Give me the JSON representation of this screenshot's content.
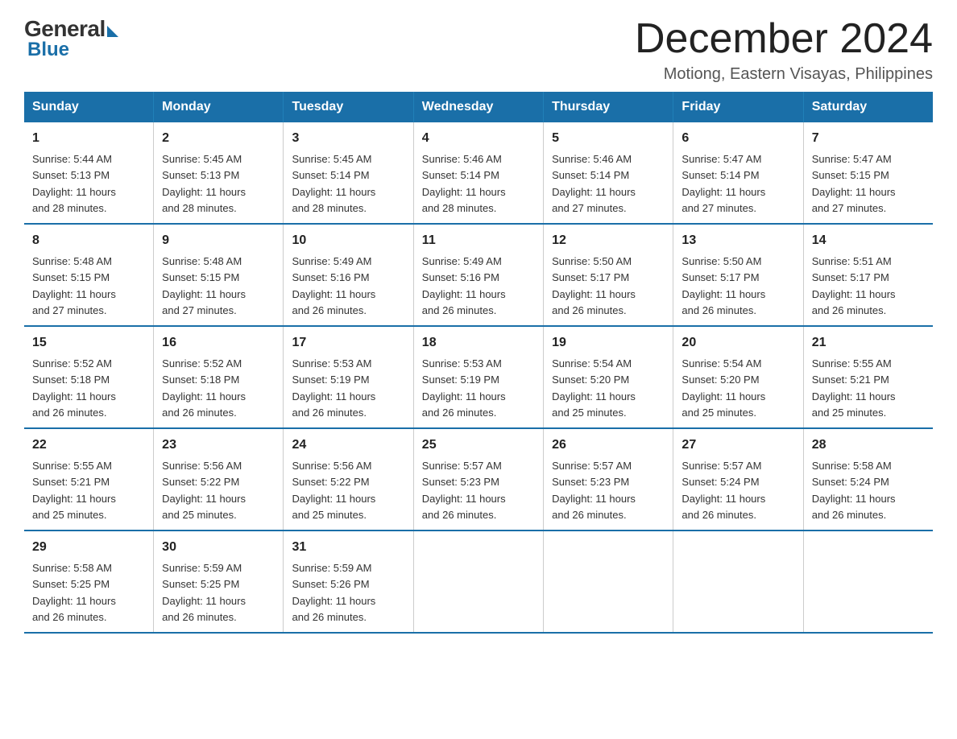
{
  "logo": {
    "general": "General",
    "blue": "Blue"
  },
  "title": "December 2024",
  "subtitle": "Motiong, Eastern Visayas, Philippines",
  "days_header": [
    "Sunday",
    "Monday",
    "Tuesday",
    "Wednesday",
    "Thursday",
    "Friday",
    "Saturday"
  ],
  "weeks": [
    [
      {
        "day": "1",
        "sunrise": "5:44 AM",
        "sunset": "5:13 PM",
        "daylight": "11 hours and 28 minutes."
      },
      {
        "day": "2",
        "sunrise": "5:45 AM",
        "sunset": "5:13 PM",
        "daylight": "11 hours and 28 minutes."
      },
      {
        "day": "3",
        "sunrise": "5:45 AM",
        "sunset": "5:14 PM",
        "daylight": "11 hours and 28 minutes."
      },
      {
        "day": "4",
        "sunrise": "5:46 AM",
        "sunset": "5:14 PM",
        "daylight": "11 hours and 28 minutes."
      },
      {
        "day": "5",
        "sunrise": "5:46 AM",
        "sunset": "5:14 PM",
        "daylight": "11 hours and 27 minutes."
      },
      {
        "day": "6",
        "sunrise": "5:47 AM",
        "sunset": "5:14 PM",
        "daylight": "11 hours and 27 minutes."
      },
      {
        "day": "7",
        "sunrise": "5:47 AM",
        "sunset": "5:15 PM",
        "daylight": "11 hours and 27 minutes."
      }
    ],
    [
      {
        "day": "8",
        "sunrise": "5:48 AM",
        "sunset": "5:15 PM",
        "daylight": "11 hours and 27 minutes."
      },
      {
        "day": "9",
        "sunrise": "5:48 AM",
        "sunset": "5:15 PM",
        "daylight": "11 hours and 27 minutes."
      },
      {
        "day": "10",
        "sunrise": "5:49 AM",
        "sunset": "5:16 PM",
        "daylight": "11 hours and 26 minutes."
      },
      {
        "day": "11",
        "sunrise": "5:49 AM",
        "sunset": "5:16 PM",
        "daylight": "11 hours and 26 minutes."
      },
      {
        "day": "12",
        "sunrise": "5:50 AM",
        "sunset": "5:17 PM",
        "daylight": "11 hours and 26 minutes."
      },
      {
        "day": "13",
        "sunrise": "5:50 AM",
        "sunset": "5:17 PM",
        "daylight": "11 hours and 26 minutes."
      },
      {
        "day": "14",
        "sunrise": "5:51 AM",
        "sunset": "5:17 PM",
        "daylight": "11 hours and 26 minutes."
      }
    ],
    [
      {
        "day": "15",
        "sunrise": "5:52 AM",
        "sunset": "5:18 PM",
        "daylight": "11 hours and 26 minutes."
      },
      {
        "day": "16",
        "sunrise": "5:52 AM",
        "sunset": "5:18 PM",
        "daylight": "11 hours and 26 minutes."
      },
      {
        "day": "17",
        "sunrise": "5:53 AM",
        "sunset": "5:19 PM",
        "daylight": "11 hours and 26 minutes."
      },
      {
        "day": "18",
        "sunrise": "5:53 AM",
        "sunset": "5:19 PM",
        "daylight": "11 hours and 26 minutes."
      },
      {
        "day": "19",
        "sunrise": "5:54 AM",
        "sunset": "5:20 PM",
        "daylight": "11 hours and 25 minutes."
      },
      {
        "day": "20",
        "sunrise": "5:54 AM",
        "sunset": "5:20 PM",
        "daylight": "11 hours and 25 minutes."
      },
      {
        "day": "21",
        "sunrise": "5:55 AM",
        "sunset": "5:21 PM",
        "daylight": "11 hours and 25 minutes."
      }
    ],
    [
      {
        "day": "22",
        "sunrise": "5:55 AM",
        "sunset": "5:21 PM",
        "daylight": "11 hours and 25 minutes."
      },
      {
        "day": "23",
        "sunrise": "5:56 AM",
        "sunset": "5:22 PM",
        "daylight": "11 hours and 25 minutes."
      },
      {
        "day": "24",
        "sunrise": "5:56 AM",
        "sunset": "5:22 PM",
        "daylight": "11 hours and 25 minutes."
      },
      {
        "day": "25",
        "sunrise": "5:57 AM",
        "sunset": "5:23 PM",
        "daylight": "11 hours and 26 minutes."
      },
      {
        "day": "26",
        "sunrise": "5:57 AM",
        "sunset": "5:23 PM",
        "daylight": "11 hours and 26 minutes."
      },
      {
        "day": "27",
        "sunrise": "5:57 AM",
        "sunset": "5:24 PM",
        "daylight": "11 hours and 26 minutes."
      },
      {
        "day": "28",
        "sunrise": "5:58 AM",
        "sunset": "5:24 PM",
        "daylight": "11 hours and 26 minutes."
      }
    ],
    [
      {
        "day": "29",
        "sunrise": "5:58 AM",
        "sunset": "5:25 PM",
        "daylight": "11 hours and 26 minutes."
      },
      {
        "day": "30",
        "sunrise": "5:59 AM",
        "sunset": "5:25 PM",
        "daylight": "11 hours and 26 minutes."
      },
      {
        "day": "31",
        "sunrise": "5:59 AM",
        "sunset": "5:26 PM",
        "daylight": "11 hours and 26 minutes."
      },
      null,
      null,
      null,
      null
    ]
  ],
  "labels": {
    "sunrise": "Sunrise:",
    "sunset": "Sunset:",
    "daylight": "Daylight:"
  }
}
